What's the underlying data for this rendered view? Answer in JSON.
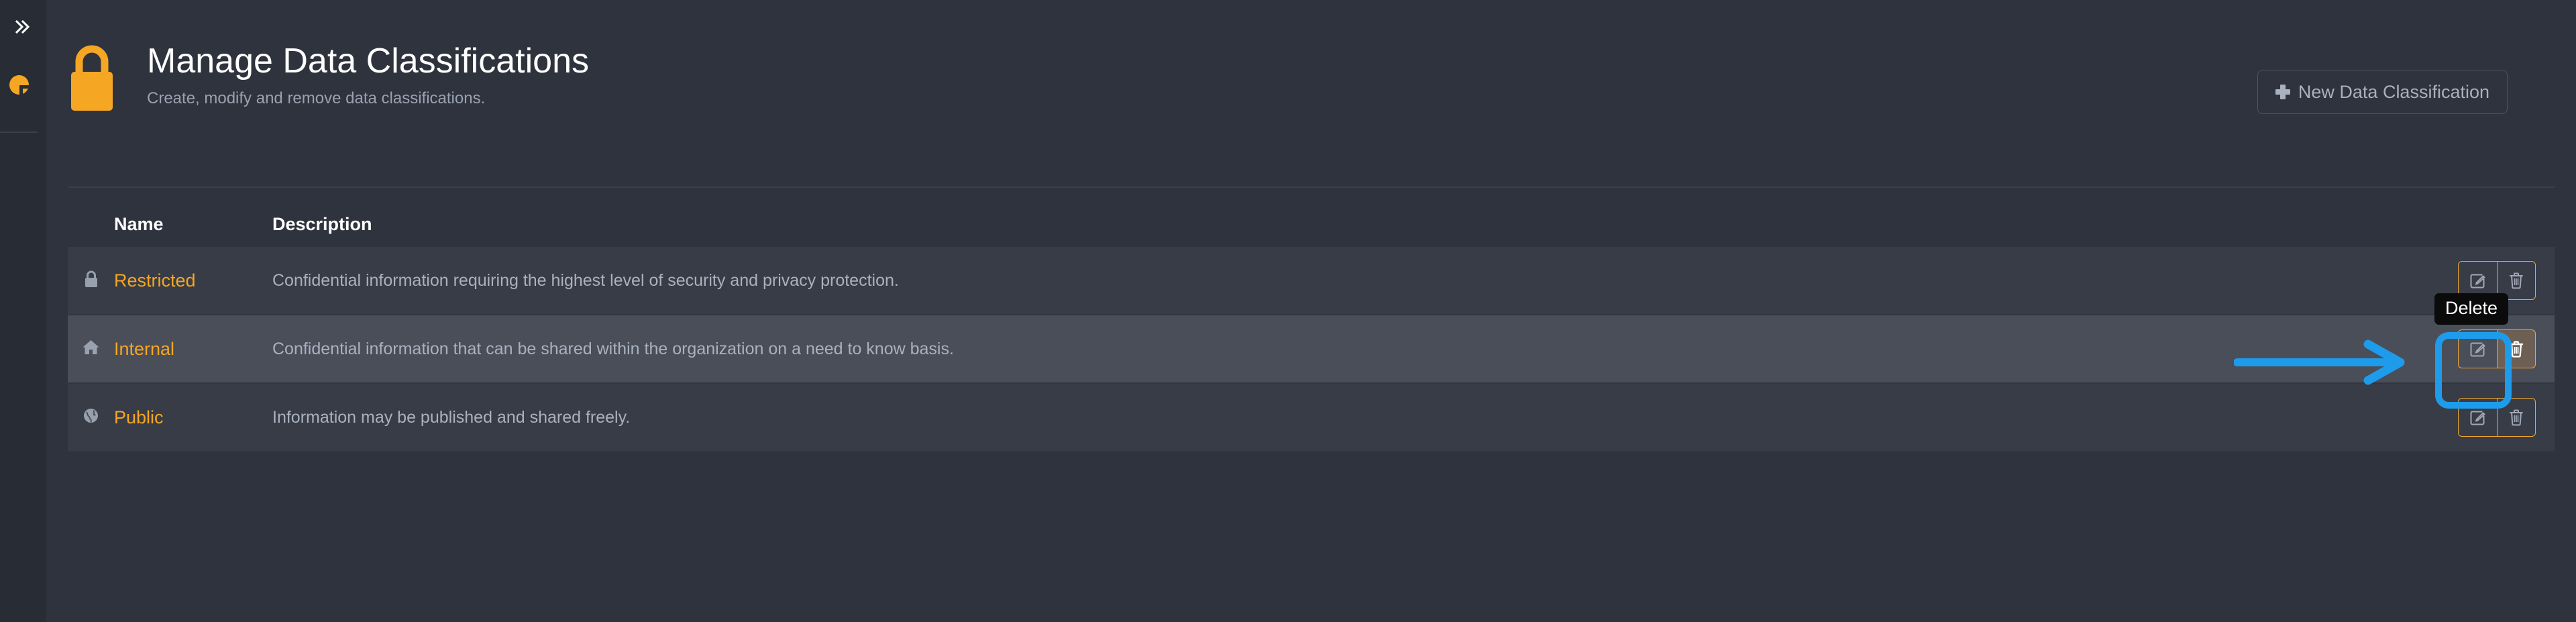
{
  "sidebar": {
    "collapse_toggle_icon": "double-chevron-right-icon",
    "add_button_icon": "plus-circle-icon"
  },
  "header": {
    "icon": "padlock-icon",
    "title": "Manage Data Classifications",
    "subtitle": "Create, modify and remove data classifications.",
    "new_button_label": "New Data Classification",
    "new_button_icon": "plus-icon"
  },
  "table": {
    "columns": [
      "Name",
      "Description"
    ],
    "rows": [
      {
        "icon": "lock-icon",
        "name": "Restricted",
        "description": "Confidential information requiring the highest level of security and privacy protection.",
        "edit_icon": "pencil-square-icon",
        "delete_icon": "trash-icon",
        "hovered": false
      },
      {
        "icon": "home-icon",
        "name": "Internal",
        "description": "Confidential information that can be shared within the organization on a need to know basis.",
        "edit_icon": "pencil-square-icon",
        "delete_icon": "trash-icon",
        "hovered": true
      },
      {
        "icon": "globe-icon",
        "name": "Public",
        "description": "Information may be published and shared freely.",
        "edit_icon": "pencil-square-icon",
        "delete_icon": "trash-icon",
        "hovered": false
      }
    ]
  },
  "tooltip": {
    "label": "Delete"
  },
  "annotation": {
    "arrow_color": "#1e9bea",
    "highlight_color": "#1e9bea"
  },
  "colors": {
    "accent": "#f5a623",
    "button_border": "#f0a732",
    "page_background": "#2f333d",
    "sidebar_background": "#282c35",
    "row_background": "#383c46",
    "row_hover_background": "#4a4e59",
    "muted_text": "#a9b1bf"
  }
}
